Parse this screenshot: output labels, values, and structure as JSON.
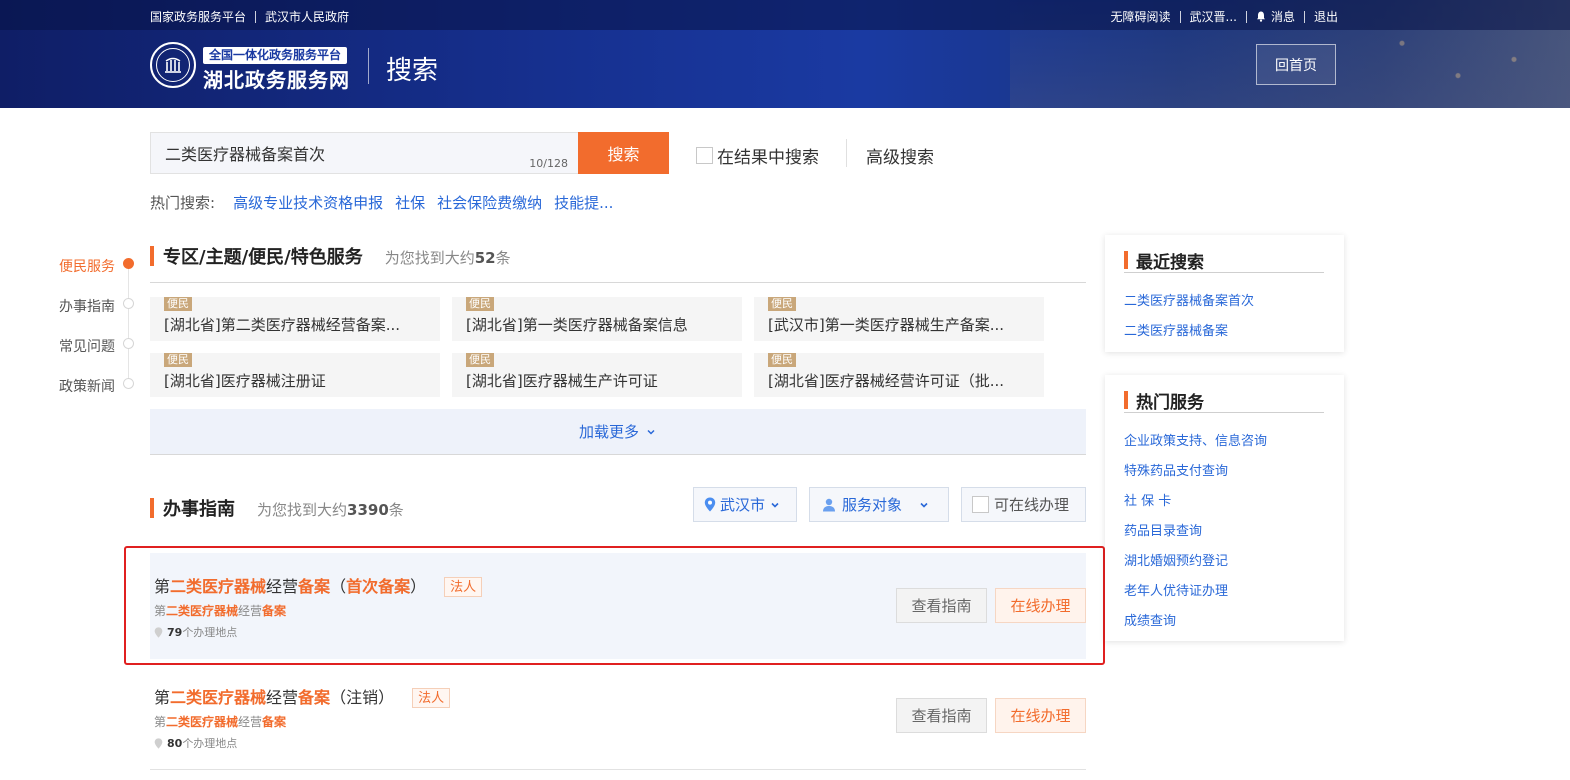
{
  "topbar": {
    "left_links": [
      "国家政务服务平台",
      "武汉市人民政府"
    ],
    "accessibility": "无障碍阅读",
    "user": "武汉晋...",
    "messages": "消息",
    "logout": "退出"
  },
  "brand": {
    "badge": "全国一体化政务服务平台",
    "name": "湖北政务服务网",
    "page_title": "搜索",
    "home_button": "回首页"
  },
  "search": {
    "query": "二类医疗器械备案首次",
    "counter": "10/128",
    "button": "搜索",
    "in_result_label": "在结果中搜索",
    "advanced_label": "高级搜索",
    "hot_label": "热门搜索:",
    "hot_links": [
      "高级专业技术资格申报",
      "社保",
      "社会保险费缴纳",
      "技能提..."
    ]
  },
  "left_nav": [
    "便民服务",
    "办事指南",
    "常见问题",
    "政策新闻"
  ],
  "services_section": {
    "title": "专区/主题/便民/特色服务",
    "found_prefix": "为您找到大约",
    "found_count": "52",
    "found_suffix": "条",
    "cards": [
      {
        "tag": "便民",
        "name": "[湖北省]第二类医疗器械经营备案..."
      },
      {
        "tag": "便民",
        "name": "[湖北省]第一类医疗器械备案信息"
      },
      {
        "tag": "便民",
        "name": "[武汉市]第一类医疗器械生产备案..."
      },
      {
        "tag": "便民",
        "name": "[湖北省]医疗器械注册证"
      },
      {
        "tag": "便民",
        "name": "[湖北省]医疗器械生产许可证"
      },
      {
        "tag": "便民",
        "name": "[湖北省]医疗器械经营许可证（批..."
      }
    ],
    "load_more": "加载更多"
  },
  "guide_section": {
    "title": "办事指南",
    "found_prefix": "为您找到大约",
    "found_count": "3390",
    "found_suffix": "条",
    "filter_city": "武汉市",
    "filter_target": "服务对象",
    "filter_online": "可在线办理",
    "results": [
      {
        "t1": "第",
        "k1": "二类医疗器械",
        "t2": "经营",
        "k2": "备案",
        "t3": "（",
        "k3": "首次备案",
        "t4": "）",
        "tag": "法人",
        "s1": "第",
        "sk1": "二类医疗器械",
        "s2": "经营",
        "sk2": "备案",
        "loc_count": "79",
        "loc_suffix": "个办理地点",
        "btn_guide": "查看指南",
        "btn_online": "在线办理"
      },
      {
        "t1": "第",
        "k1": "二类医疗器械",
        "t2": "经营",
        "k2": "备案",
        "t3": "（注销）",
        "tag": "法人",
        "s1": "第",
        "sk1": "二类医疗器械",
        "s2": "经营",
        "sk2": "备案",
        "loc_count": "80",
        "loc_suffix": "个办理地点",
        "btn_guide": "查看指南",
        "btn_online": "在线办理"
      }
    ]
  },
  "recent_search": {
    "title": "最近搜索",
    "items": [
      "二类医疗器械备案首次",
      "二类医疗器械备案"
    ]
  },
  "hot_services": {
    "title": "热门服务",
    "items": [
      "企业政策支持、信息咨询",
      "特殊药品支付查询",
      "社 保 卡",
      "药品目录查询",
      "湖北婚姻预约登记",
      "老年人优待证办理",
      "成绩查询"
    ]
  },
  "colors": {
    "accent": "#f26c2d",
    "link": "#2968d8",
    "header": "#1a3aa2",
    "highlight_frame": "#e02020"
  }
}
